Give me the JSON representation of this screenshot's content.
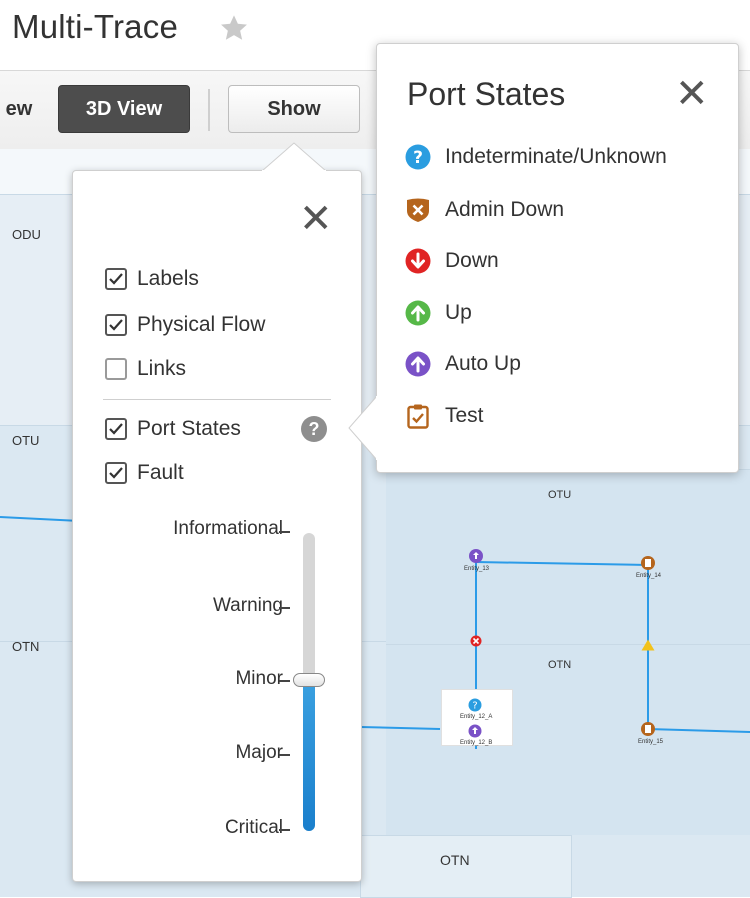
{
  "header": {
    "title": "Multi-Trace",
    "favorite_icon": "star-icon"
  },
  "toolbar": {
    "view2d_label": "ew",
    "view3d_label": "3D View",
    "show_label": "Show"
  },
  "canvas": {
    "lanes_left": [
      "ODU",
      "OTU",
      "OTN"
    ],
    "lanes_right": [
      "OTU",
      "OTN"
    ],
    "bottom_lane": "OTN",
    "entities": [
      "Entity_13",
      "Entity_14",
      "Entity_12_A",
      "Entity_12_B",
      "Entity_15"
    ]
  },
  "show_panel": {
    "close_icon": "close-icon",
    "options": [
      {
        "label": "Labels",
        "checked": true
      },
      {
        "label": "Physical Flow",
        "checked": true
      },
      {
        "label": "Links",
        "checked": false
      },
      {
        "label": "Port States",
        "checked": true
      },
      {
        "label": "Fault",
        "checked": true
      }
    ],
    "help_glyph": "?",
    "severity_levels": [
      "Informational",
      "Warning",
      "Minor",
      "Major",
      "Critical"
    ],
    "slider_selected": "Minor"
  },
  "port_states": {
    "title": "Port States",
    "close_icon": "close-icon",
    "items": [
      {
        "label": "Indeterminate/Unknown",
        "icon": "question-circle-icon",
        "color": "#2a9de0"
      },
      {
        "label": "Admin Down",
        "icon": "admin-down-shield-icon",
        "color": "#b5651d"
      },
      {
        "label": "Down",
        "icon": "down-arrow-circle-icon",
        "color": "#e02424"
      },
      {
        "label": "Up",
        "icon": "up-arrow-circle-icon",
        "color": "#56b848"
      },
      {
        "label": "Auto Up",
        "icon": "auto-up-arrow-circle-icon",
        "color": "#7a52c7"
      },
      {
        "label": "Test",
        "icon": "clipboard-check-icon",
        "color": "#b5651d"
      }
    ]
  },
  "colors": {
    "link": "#2b9be8",
    "toolbar_active": "#4d4d4d",
    "slider_fill": "#1a7fcc"
  }
}
